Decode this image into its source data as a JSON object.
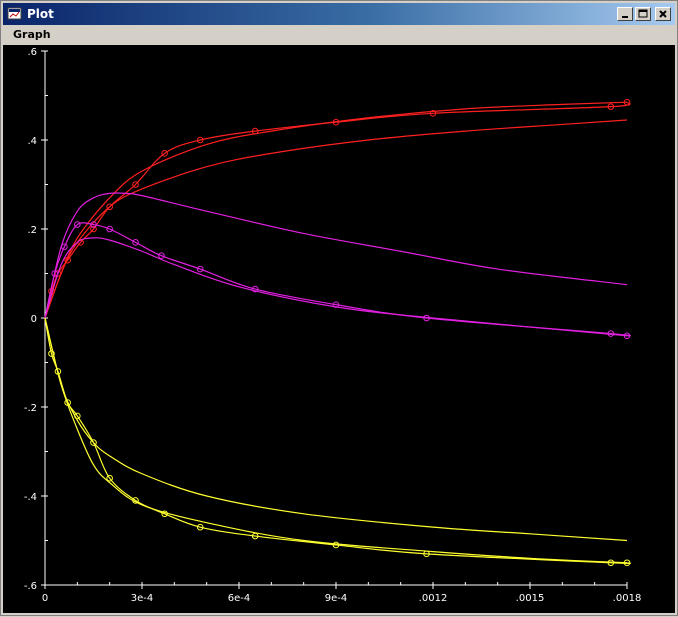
{
  "window": {
    "title": "Plot"
  },
  "menu": {
    "items": [
      {
        "label": "Graph"
      }
    ]
  },
  "chart_data": {
    "type": "line",
    "xlim": [
      0,
      0.0018
    ],
    "ylim": [
      -0.6,
      0.6
    ],
    "x_ticks": [
      {
        "value": 0,
        "label": "0"
      },
      {
        "value": 0.0003,
        "label": "3e-4"
      },
      {
        "value": 0.0006,
        "label": "6e-4"
      },
      {
        "value": 0.0009,
        "label": "9e-4"
      },
      {
        "value": 0.0012,
        "label": ".0012"
      },
      {
        "value": 0.0015,
        "label": ".0015"
      },
      {
        "value": 0.0018,
        "label": ".0018"
      }
    ],
    "y_ticks": [
      {
        "value": 0.6,
        "label": ".6"
      },
      {
        "value": 0.4,
        "label": ".4"
      },
      {
        "value": 0.2,
        "label": ".2"
      },
      {
        "value": 0,
        "label": "0"
      },
      {
        "value": -0.2,
        "label": "-.2"
      },
      {
        "value": -0.4,
        "label": "-.4"
      },
      {
        "value": -0.6,
        "label": "-.6"
      }
    ],
    "grid": false,
    "background": "#000000",
    "axis_color": "#ffffff",
    "series": [
      {
        "color": "#ff2020",
        "markers": true,
        "x": [
          0,
          2e-05,
          4e-05,
          7e-05,
          0.00011,
          0.00015,
          0.0002,
          0.00028,
          0.00037,
          0.00048,
          0.00065,
          0.0009,
          0.0012,
          0.00175,
          0.0018
        ],
        "y": [
          0,
          0.06,
          0.1,
          0.13,
          0.17,
          0.2,
          0.25,
          0.3,
          0.37,
          0.4,
          0.42,
          0.44,
          0.46,
          0.475,
          0.485
        ]
      },
      {
        "color": "#ff2020",
        "markers": false,
        "x": [
          0,
          5e-05,
          0.0001,
          0.0002,
          0.0003,
          0.0005,
          0.0007,
          0.001,
          0.0013,
          0.0016,
          0.0018
        ],
        "y": [
          0,
          0.1,
          0.18,
          0.27,
          0.33,
          0.39,
          0.42,
          0.45,
          0.47,
          0.48,
          0.485
        ]
      },
      {
        "color": "#ff2020",
        "markers": false,
        "x": [
          0,
          5e-05,
          0.0001,
          0.0002,
          0.0003,
          0.0005,
          0.0007,
          0.001,
          0.0013,
          0.0016,
          0.0018
        ],
        "y": [
          0,
          0.1,
          0.17,
          0.25,
          0.29,
          0.34,
          0.37,
          0.4,
          0.42,
          0.435,
          0.445
        ]
      },
      {
        "color": "#e020e0",
        "markers": false,
        "x": [
          0,
          5e-05,
          0.0001,
          0.00015,
          0.0002,
          0.00025,
          0.0003,
          0.0005,
          0.0008,
          0.0011,
          0.0014,
          0.0018
        ],
        "y": [
          0,
          0.16,
          0.24,
          0.27,
          0.28,
          0.28,
          0.275,
          0.24,
          0.19,
          0.15,
          0.11,
          0.075
        ]
      },
      {
        "color": "#e020e0",
        "markers": true,
        "x": [
          0,
          3e-05,
          6e-05,
          0.0001,
          0.00015,
          0.0002,
          0.00028,
          0.00036,
          0.00048,
          0.00065,
          0.0009,
          0.00118,
          0.00175,
          0.0018
        ],
        "y": [
          0,
          0.1,
          0.16,
          0.21,
          0.21,
          0.2,
          0.17,
          0.14,
          0.11,
          0.065,
          0.03,
          0,
          -0.035,
          -0.04
        ]
      },
      {
        "color": "#e020e0",
        "markers": false,
        "x": [
          0,
          5e-05,
          0.0001,
          0.00015,
          0.0002,
          0.0003,
          0.0004,
          0.0006,
          0.0009,
          0.0012,
          0.0018
        ],
        "y": [
          0,
          0.12,
          0.17,
          0.18,
          0.175,
          0.15,
          0.12,
          0.07,
          0.025,
          0,
          -0.04
        ]
      },
      {
        "color": "#ffff30",
        "markers": true,
        "x": [
          0,
          2e-05,
          4e-05,
          7e-05,
          0.0001,
          0.00015,
          0.0002,
          0.00028,
          0.00037,
          0.00048,
          0.00065,
          0.0009,
          0.00118,
          0.00175,
          0.0018
        ],
        "y": [
          0,
          -0.08,
          -0.12,
          -0.19,
          -0.22,
          -0.28,
          -0.36,
          -0.41,
          -0.44,
          -0.47,
          -0.49,
          -0.51,
          -0.53,
          -0.55,
          -0.55
        ]
      },
      {
        "color": "#ffff30",
        "markers": false,
        "x": [
          0,
          5e-05,
          0.0001,
          0.00015,
          0.0002,
          0.0003,
          0.0005,
          0.0008,
          0.0012,
          0.0015,
          0.0018
        ],
        "y": [
          0,
          -0.15,
          -0.25,
          -0.33,
          -0.37,
          -0.42,
          -0.46,
          -0.5,
          -0.525,
          -0.54,
          -0.55
        ]
      },
      {
        "color": "#ffff30",
        "markers": false,
        "x": [
          0,
          5e-05,
          0.0001,
          0.00015,
          0.0002,
          0.0003,
          0.0005,
          0.0008,
          0.0012,
          0.0015,
          0.0018
        ],
        "y": [
          0,
          -0.15,
          -0.23,
          -0.28,
          -0.31,
          -0.35,
          -0.4,
          -0.44,
          -0.47,
          -0.485,
          -0.5
        ]
      }
    ]
  }
}
